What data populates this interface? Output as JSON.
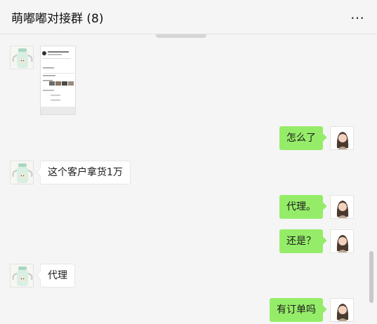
{
  "chat": {
    "title": "萌嘟嘟对接群 (8)",
    "more_label": "…"
  },
  "messages": [
    {
      "side": "left",
      "kind": "image"
    },
    {
      "side": "right",
      "text": "怎么了"
    },
    {
      "side": "left",
      "text": "这个客户拿货1万"
    },
    {
      "side": "right",
      "text": "代理。"
    },
    {
      "side": "right",
      "text": "还是？"
    },
    {
      "side": "left",
      "text": "代理"
    },
    {
      "side": "right",
      "text": "有订单吗"
    }
  ],
  "colors": {
    "background": "#f5f5f5",
    "outgoing_bubble": "#95ec69",
    "incoming_bubble": "#ffffff"
  },
  "icons": {
    "more": "more-dots-icon",
    "left_avatar": "baby-bottle-avatar-icon",
    "right_avatar": "girl-avatar-icon"
  }
}
